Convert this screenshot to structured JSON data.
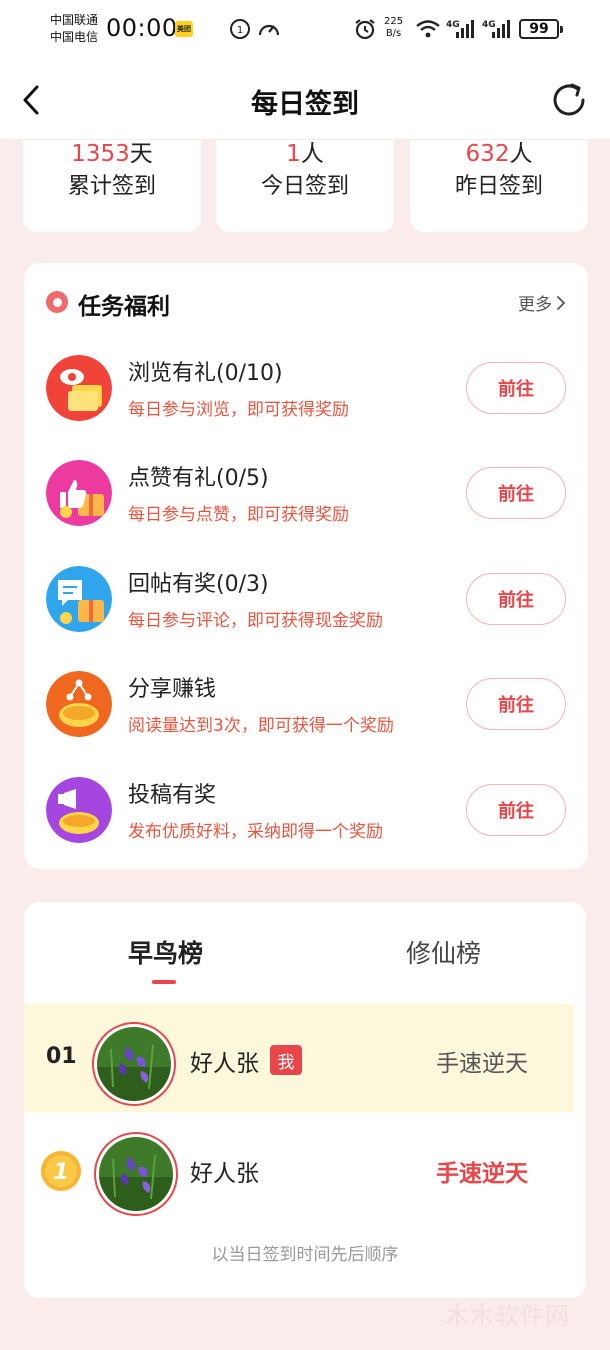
{
  "status_bar": {
    "carrier1": "中国联通",
    "carrier2": "中国电信",
    "time": "00:00",
    "app_badge": "美团",
    "net_speed_value": "225",
    "net_speed_unit": "B/s",
    "network1": "4G",
    "network2": "4G",
    "battery": "99"
  },
  "nav": {
    "title": "每日签到"
  },
  "stats": [
    {
      "value": "1353",
      "unit": "天",
      "label": "累计签到"
    },
    {
      "value": "1",
      "unit": "人",
      "label": "今日签到"
    },
    {
      "value": "632",
      "unit": "人",
      "label": "昨日签到"
    }
  ],
  "tasks": {
    "title": "任务福利",
    "more": "更多",
    "button_label": "前往",
    "items": [
      {
        "name": "浏览有礼(0/10)",
        "desc": "每日参与浏览，即可获得奖励",
        "icon": "browse-gift-icon",
        "color": "#f0433a"
      },
      {
        "name": "点赞有礼(0/5)",
        "desc": "每日参与点赞，即可获得奖励",
        "icon": "like-gift-icon",
        "color": "#ec3aa0"
      },
      {
        "name": "回帖有奖(0/3)",
        "desc": "每日参与评论，即可获得现金奖励",
        "icon": "reply-gift-icon",
        "color": "#2fa5ec"
      },
      {
        "name": "分享赚钱",
        "desc": "阅读量达到3次，即可获得一个奖励",
        "icon": "share-money-icon",
        "color": "#f0671f"
      },
      {
        "name": "投稿有奖",
        "desc": "发布优质好料，采纳即得一个奖励",
        "icon": "submit-reward-icon",
        "color": "#a546e0"
      }
    ]
  },
  "ranking": {
    "tabs": [
      "早鸟榜",
      "修仙榜"
    ],
    "me_row": {
      "rank": "01",
      "name": "好人张",
      "badge": "我",
      "tag": "手速逆天"
    },
    "first_row": {
      "medal": "1",
      "name": "好人张",
      "tag": "手速逆天"
    },
    "footer": "以当日签到时间先后顺序"
  },
  "watermark": "木木软件网"
}
